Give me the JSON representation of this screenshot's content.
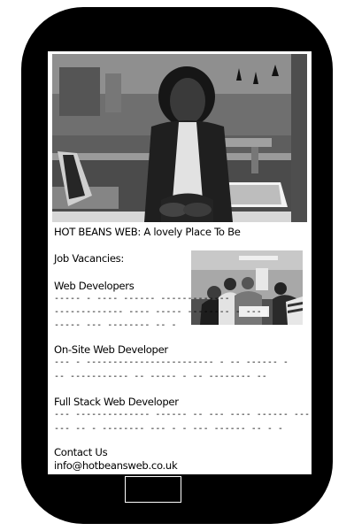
{
  "header": {
    "title": "HOT  BEANS WEB: A lovely Place To Be"
  },
  "jobs": {
    "heading": "Job Vacancies:",
    "items": [
      {
        "title": "Web Developers",
        "lines": [
          "----- - ---- ------ -------------",
          "------------- ---- -----    -------- - ---",
          "----- ---    -------- -- -"
        ]
      },
      {
        "title": "On-Site Web Developer",
        "lines": [
          "--- - ------------------------ - -- ------ -",
          "-- ----------- --        ----- - -- -------- --"
        ]
      },
      {
        "title": "Full Stack Web Developer",
        "lines": [
          "--- -------------- ------ -- --- ---- ------ --- ---------- ---",
          "--- -- - -------- --- - -   --- ------ -- - -"
        ]
      }
    ]
  },
  "contact": {
    "heading": "Contact Us",
    "email": "info@hotbeansweb.co.uk"
  },
  "icons": {
    "home": "home-button"
  },
  "colors": {
    "phone_body": "#000000",
    "screen_bg": "#ffffff",
    "text": "#000000"
  }
}
